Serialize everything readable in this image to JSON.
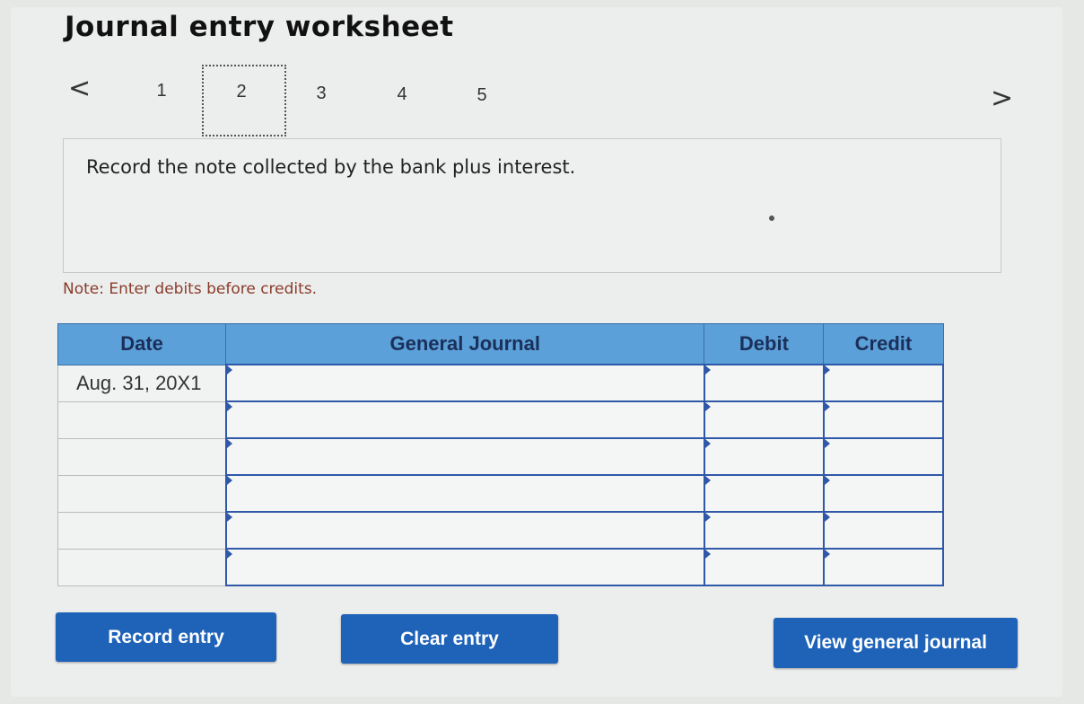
{
  "header": {
    "title": "Journal entry worksheet"
  },
  "pagination": {
    "prev_icon": "chevron-left-icon",
    "next_icon": "chevron-right-icon",
    "prev_glyph": "<",
    "next_glyph": ">",
    "pages": [
      "1",
      "2",
      "3",
      "4",
      "5"
    ],
    "current": "2"
  },
  "question": {
    "text": "Record the note collected by the bank plus interest."
  },
  "note": {
    "text": "Note: Enter debits before credits."
  },
  "table": {
    "headers": {
      "date": "Date",
      "general_journal": "General Journal",
      "debit": "Debit",
      "credit": "Credit"
    },
    "rows": [
      {
        "date": "Aug. 31, 20X1",
        "account": "",
        "debit": "",
        "credit": ""
      },
      {
        "date": "",
        "account": "",
        "debit": "",
        "credit": ""
      },
      {
        "date": "",
        "account": "",
        "debit": "",
        "credit": ""
      },
      {
        "date": "",
        "account": "",
        "debit": "",
        "credit": ""
      },
      {
        "date": "",
        "account": "",
        "debit": "",
        "credit": ""
      },
      {
        "date": "",
        "account": "",
        "debit": "",
        "credit": ""
      }
    ]
  },
  "buttons": {
    "record_entry": "Record entry",
    "clear_entry": "Clear entry",
    "view_general_journal": "View general journal"
  },
  "colors": {
    "button_blue": "#1e63b8",
    "header_blue": "#5ba0d8",
    "note_red": "#8a3b2a"
  }
}
